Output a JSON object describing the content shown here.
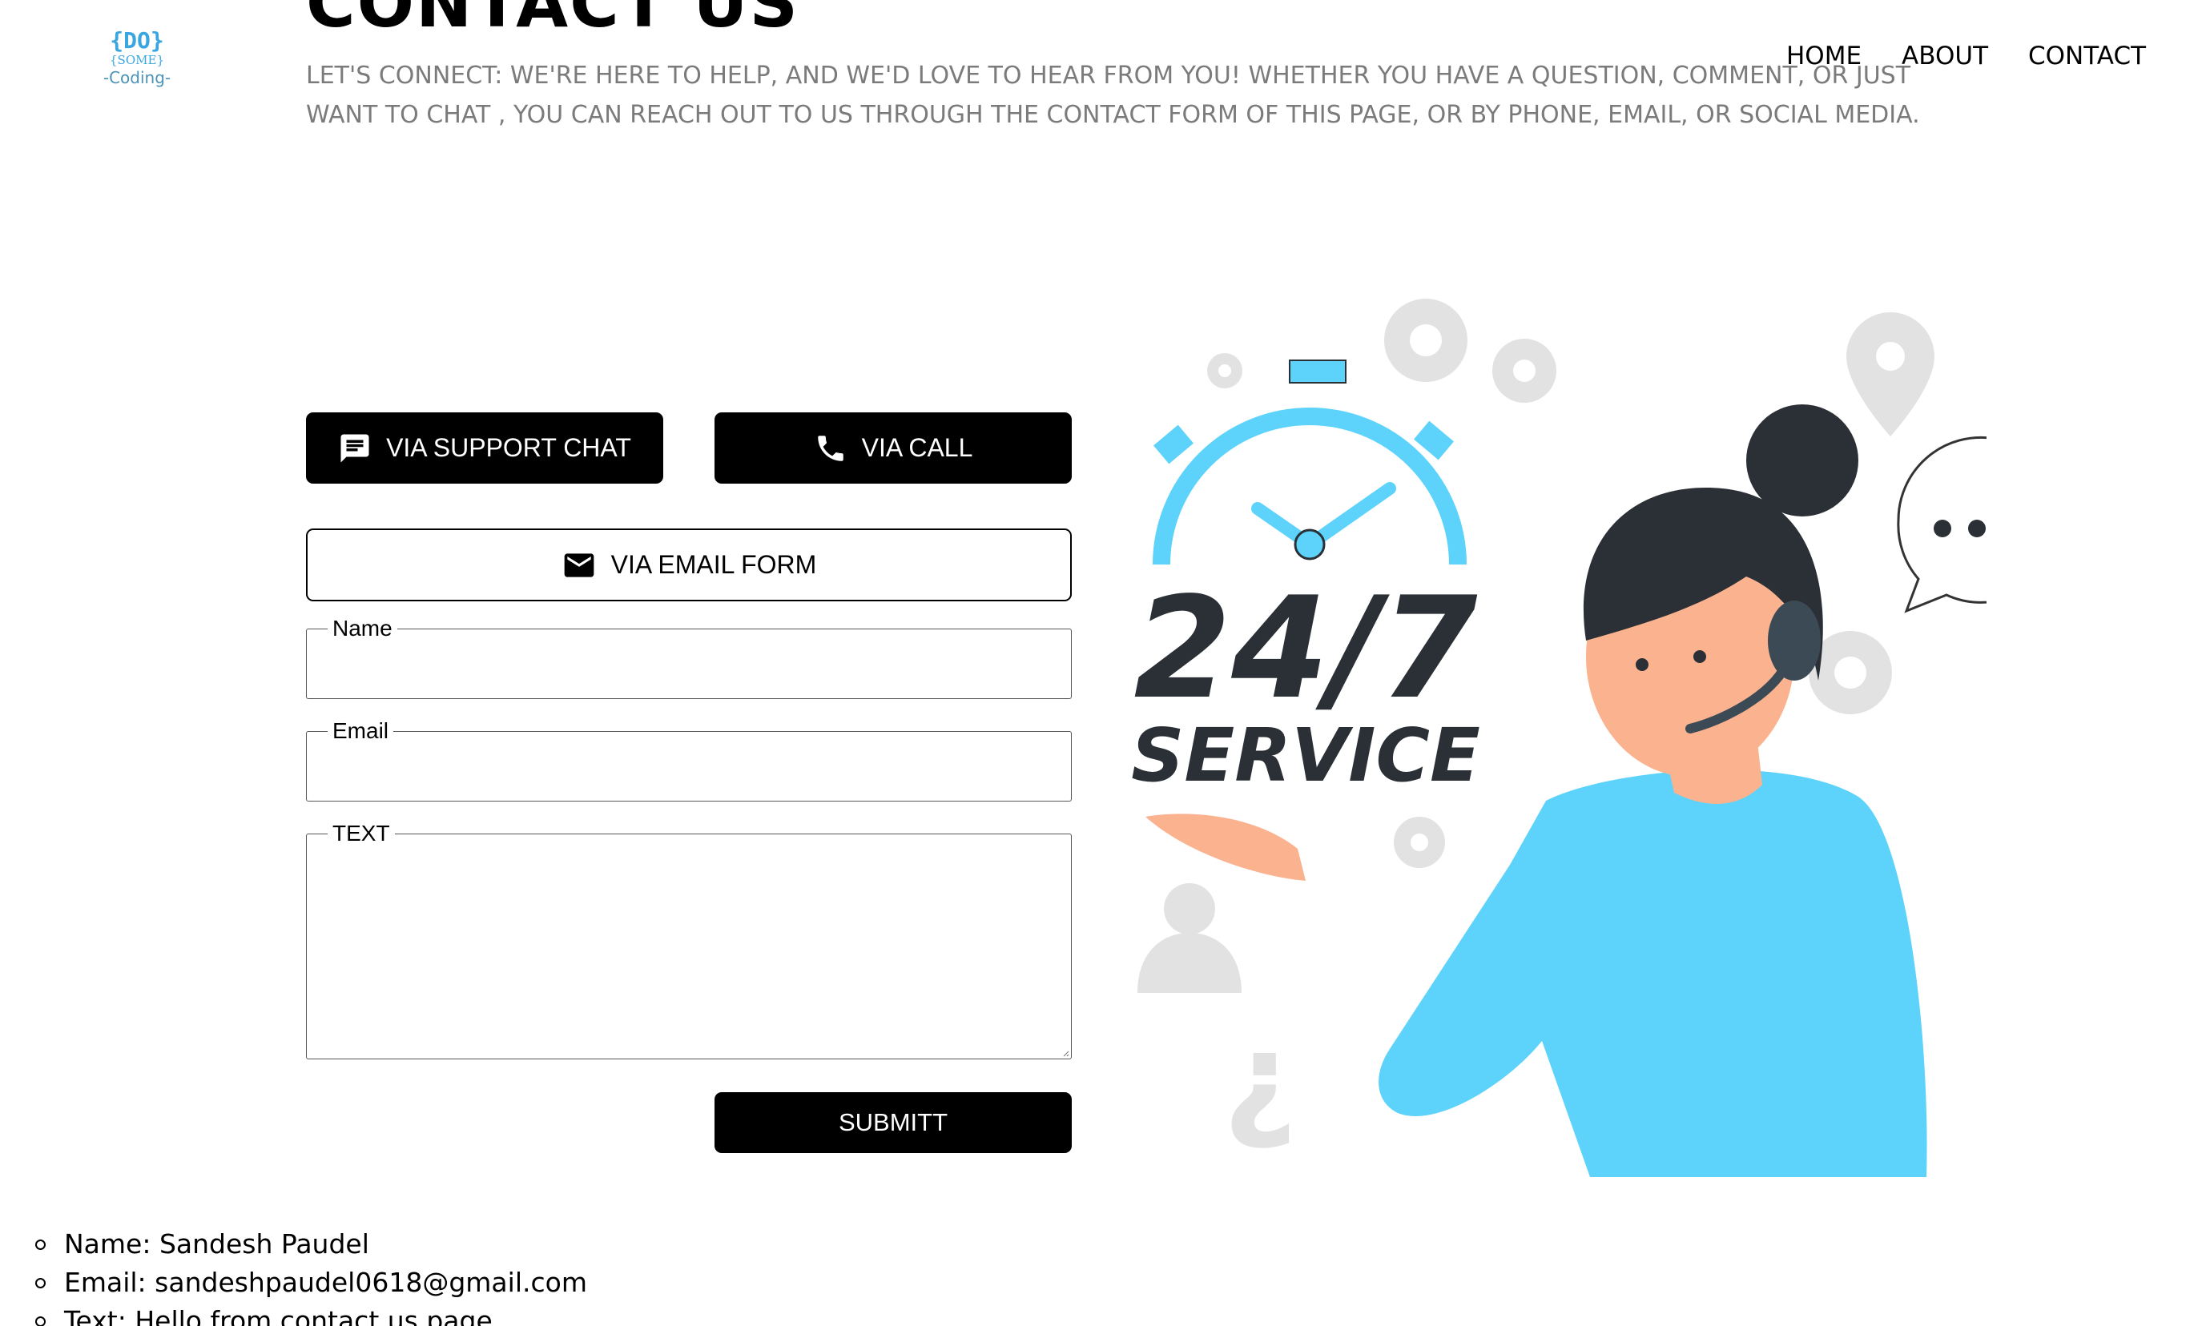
{
  "logo": {
    "top_text": "{DO}",
    "middle_text": "{SOME}",
    "bottom_text": "-Coding-"
  },
  "header": {
    "title": "CONTACT US",
    "intro": "LET'S CONNECT: WE'RE HERE TO HELP, AND WE'D LOVE TO HEAR FROM YOU! WHETHER YOU HAVE A QUESTION, COMMENT, OR JUST WANT TO CHAT , YOU CAN REACH OUT TO US THROUGH THE CONTACT FORM OF THIS PAGE, OR BY PHONE, EMAIL, OR SOCIAL MEDIA."
  },
  "nav": {
    "items": [
      "HOME",
      "ABOUT",
      "CONTACT"
    ]
  },
  "contact_options": {
    "chat_label": "VIA SUPPORT CHAT",
    "call_label": "VIA CALL",
    "email_label": "VIA EMAIL FORM"
  },
  "form": {
    "name_label": "Name",
    "email_label": "Email",
    "text_label": "TEXT",
    "submit_label": "SUBMITT"
  },
  "illustration": {
    "headline": "24/7",
    "subline": "SERVICE"
  },
  "submitted": {
    "name": "Name: Sandesh Paudel",
    "email": "Email: sandeshpaudel0618@gmail.com",
    "text": "Text: Hello from contact us page"
  },
  "colors": {
    "accent": "#5dd3fb",
    "dark": "#2a3036",
    "gray_icons": "#e0e0e0",
    "skin": "#fbb28f"
  }
}
